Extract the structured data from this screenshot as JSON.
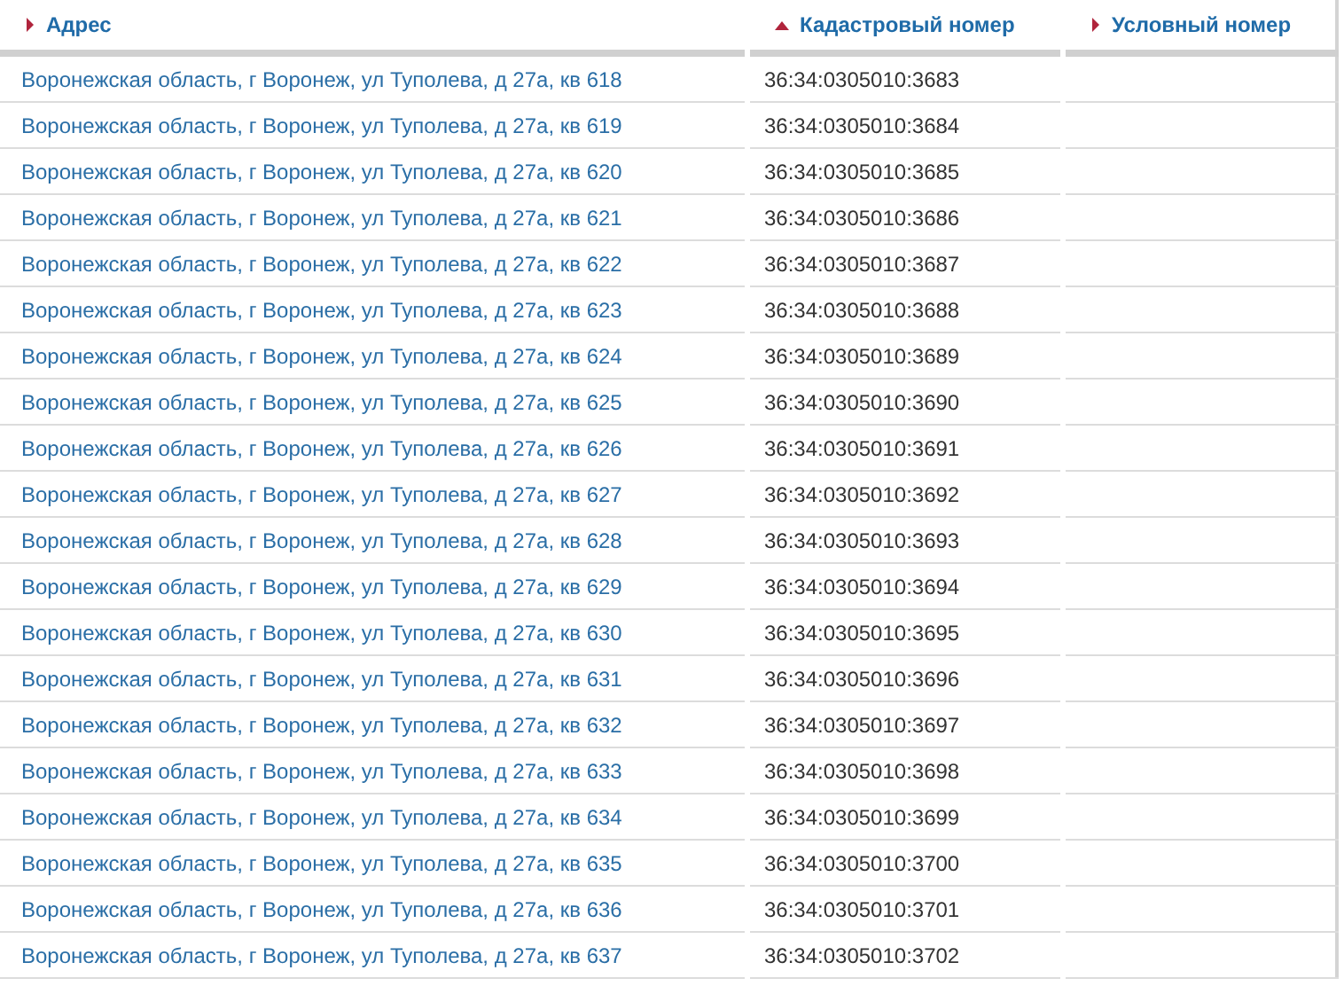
{
  "table": {
    "columns": [
      {
        "label": "Адрес",
        "sorted": false
      },
      {
        "label": "Кадастровый номер",
        "sorted": true
      },
      {
        "label": "Условный номер",
        "sorted": false
      }
    ],
    "rows": [
      {
        "address": "Воронежская область, г Воронеж, ул Туполева, д 27а, кв 618",
        "cadastral": "36:34:0305010:3683"
      },
      {
        "address": "Воронежская область, г Воронеж, ул Туполева, д 27а, кв 619",
        "cadastral": "36:34:0305010:3684"
      },
      {
        "address": "Воронежская область, г Воронеж, ул Туполева, д 27а, кв 620",
        "cadastral": "36:34:0305010:3685"
      },
      {
        "address": "Воронежская область, г Воронеж, ул Туполева, д 27а, кв 621",
        "cadastral": "36:34:0305010:3686"
      },
      {
        "address": "Воронежская область, г Воронеж, ул Туполева, д 27а, кв 622",
        "cadastral": "36:34:0305010:3687"
      },
      {
        "address": "Воронежская область, г Воронеж, ул Туполева, д 27а, кв 623",
        "cadastral": "36:34:0305010:3688"
      },
      {
        "address": "Воронежская область, г Воронеж, ул Туполева, д 27а, кв 624",
        "cadastral": "36:34:0305010:3689"
      },
      {
        "address": "Воронежская область, г Воронеж, ул Туполева, д 27а, кв 625",
        "cadastral": "36:34:0305010:3690"
      },
      {
        "address": "Воронежская область, г Воронеж, ул Туполева, д 27а, кв 626",
        "cadastral": "36:34:0305010:3691"
      },
      {
        "address": "Воронежская область, г Воронеж, ул Туполева, д 27а, кв 627",
        "cadastral": "36:34:0305010:3692"
      },
      {
        "address": "Воронежская область, г Воронеж, ул Туполева, д 27а, кв 628",
        "cadastral": "36:34:0305010:3693"
      },
      {
        "address": "Воронежская область, г Воронеж, ул Туполева, д 27а, кв 629",
        "cadastral": "36:34:0305010:3694"
      },
      {
        "address": "Воронежская область, г Воронеж, ул Туполева, д 27а, кв 630",
        "cadastral": "36:34:0305010:3695"
      },
      {
        "address": "Воронежская область, г Воронеж, ул Туполева, д 27а, кв 631",
        "cadastral": "36:34:0305010:3696"
      },
      {
        "address": "Воронежская область, г Воронеж, ул Туполева, д 27а, кв 632",
        "cadastral": "36:34:0305010:3697"
      },
      {
        "address": "Воронежская область, г Воронеж, ул Туполева, д 27а, кв 633",
        "cadastral": "36:34:0305010:3698"
      },
      {
        "address": "Воронежская область, г Воронеж, ул Туполева, д 27а, кв 634",
        "cadastral": "36:34:0305010:3699"
      },
      {
        "address": "Воронежская область, г Воронеж, ул Туполева, д 27а, кв 635",
        "cadastral": "36:34:0305010:3700"
      },
      {
        "address": "Воронежская область, г Воронеж, ул Туполева, д 27а, кв 636",
        "cadastral": "36:34:0305010:3701"
      },
      {
        "address": "Воронежская область, г Воронеж, ул Туполева, д 27а, кв 637",
        "cadastral": "36:34:0305010:3702"
      }
    ]
  }
}
